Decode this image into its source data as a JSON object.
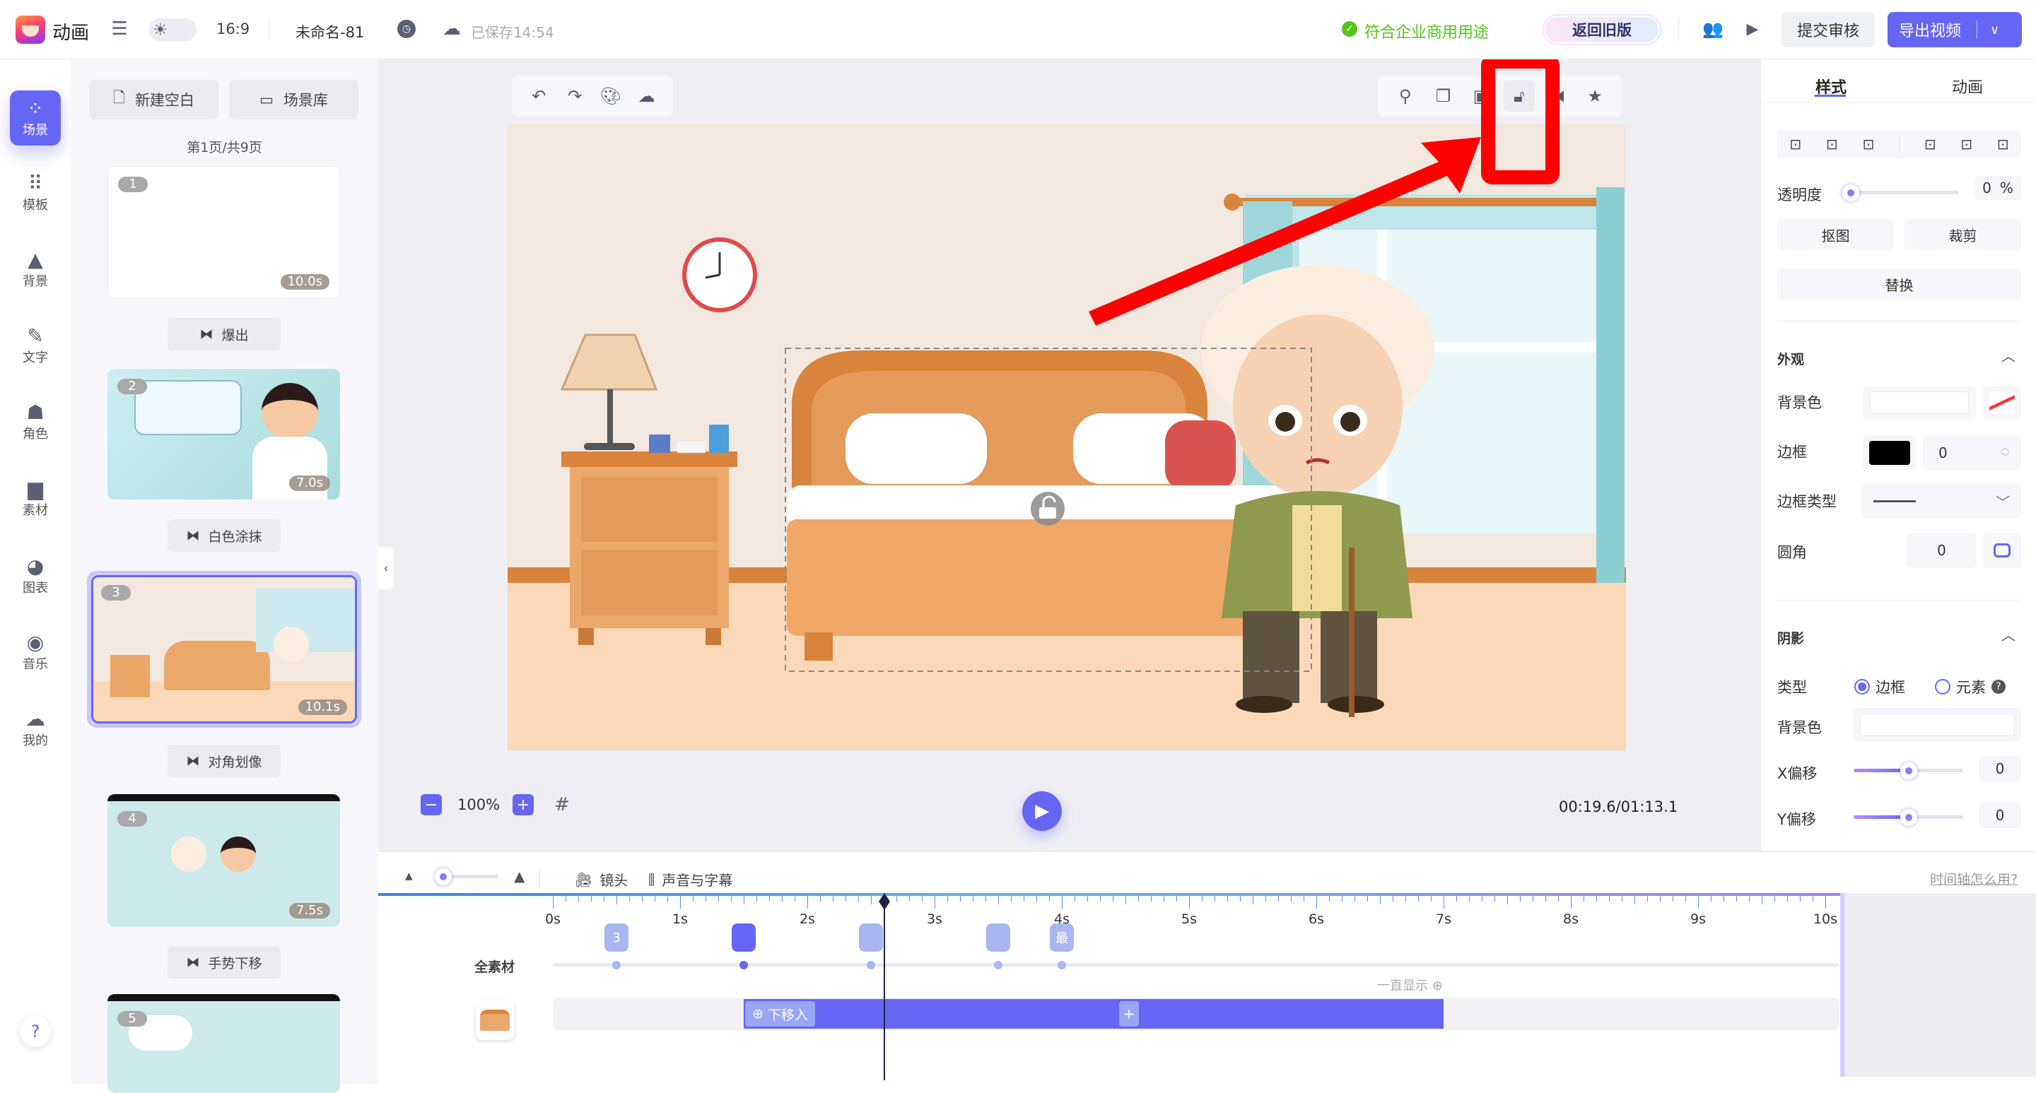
{
  "topbar": {
    "app_name": "动画",
    "aspect_ratio": "16:9",
    "project_name": "未命名-81",
    "save_status": "已保存14:54",
    "commercial_status": "符合企业商用用途",
    "back_old_label": "返回旧版",
    "submit_label": "提交审核",
    "export_label": "导出视频",
    "accent_color": "#6666f5",
    "success_color": "#52c41a"
  },
  "rail": {
    "items": [
      {
        "label": "场景",
        "icon": "scene-icon",
        "active": true
      },
      {
        "label": "模板",
        "icon": "template-icon"
      },
      {
        "label": "背景",
        "icon": "background-icon"
      },
      {
        "label": "文字",
        "icon": "text-icon"
      },
      {
        "label": "角色",
        "icon": "character-icon"
      },
      {
        "label": "素材",
        "icon": "material-icon"
      },
      {
        "label": "图表",
        "icon": "chart-icon"
      },
      {
        "label": "音乐",
        "icon": "music-icon"
      },
      {
        "label": "我的",
        "icon": "my-icon"
      }
    ],
    "help": "?"
  },
  "scenes": {
    "new_blank": "新建空白",
    "scene_library": "场景库",
    "pagination": "第1页/共9页",
    "cards": [
      {
        "num": "1",
        "duration": "10.0s"
      },
      {
        "num": "2",
        "duration": "7.0s"
      },
      {
        "num": "3",
        "duration": "10.1s",
        "selected": true
      },
      {
        "num": "4",
        "duration": "7.5s"
      },
      {
        "num": "5"
      }
    ],
    "transitions": [
      "爆出",
      "白色涂抹",
      "对角划像",
      "手势下移"
    ]
  },
  "canvas": {
    "tooltip": "解锁",
    "zoom": "100%",
    "time": "00:19.6/01:13.1",
    "left_tools": [
      "undo-icon",
      "redo-icon",
      "palette-icon",
      "upload-icon"
    ],
    "right_tools": [
      "location-icon",
      "copy-icon",
      "layer-icon",
      "unlock-icon",
      "flip-icon",
      "star-icon"
    ]
  },
  "right_panel": {
    "tabs": [
      "样式",
      "动画"
    ],
    "active_tab": "样式",
    "opacity_label": "透明度",
    "opacity_value": "0",
    "opacity_unit": "%",
    "cutout": "抠图",
    "crop": "裁剪",
    "replace": "替换",
    "appearance": {
      "title": "外观",
      "bg_color": "背景色",
      "border": "边框",
      "border_value": "0",
      "border_color": "#000000",
      "border_type": "边框类型",
      "radius": "圆角",
      "radius_value": "0"
    },
    "shadow": {
      "title": "阴影",
      "type_label": "类型",
      "type_options": [
        "边框",
        "元素"
      ],
      "type_selected": "边框",
      "bg_color": "背景色",
      "x_offset": "X偏移",
      "x_value": "0",
      "y_offset": "Y偏移",
      "y_value": "0"
    }
  },
  "timeline": {
    "camera": "镜头",
    "audio": "声音与字幕",
    "help": "时间轴怎么用?",
    "ticks": [
      "0s",
      "1s",
      "2s",
      "3s",
      "4s",
      "5s",
      "6s",
      "7s",
      "8s",
      "9s",
      "10s"
    ],
    "playhead_s": 2.6,
    "track_label": "全素材",
    "markers": [
      {
        "t": 0.5,
        "label": "3"
      },
      {
        "t": 1.5,
        "label": ""
      },
      {
        "t": 2.5,
        "label": ""
      },
      {
        "t": 3.5,
        "label": ""
      },
      {
        "t": 4.0,
        "label": "最"
      }
    ],
    "clip": {
      "start_s": 1.5,
      "end_s": 7.0,
      "effect": "下移入",
      "always_show": "一直显示"
    }
  }
}
